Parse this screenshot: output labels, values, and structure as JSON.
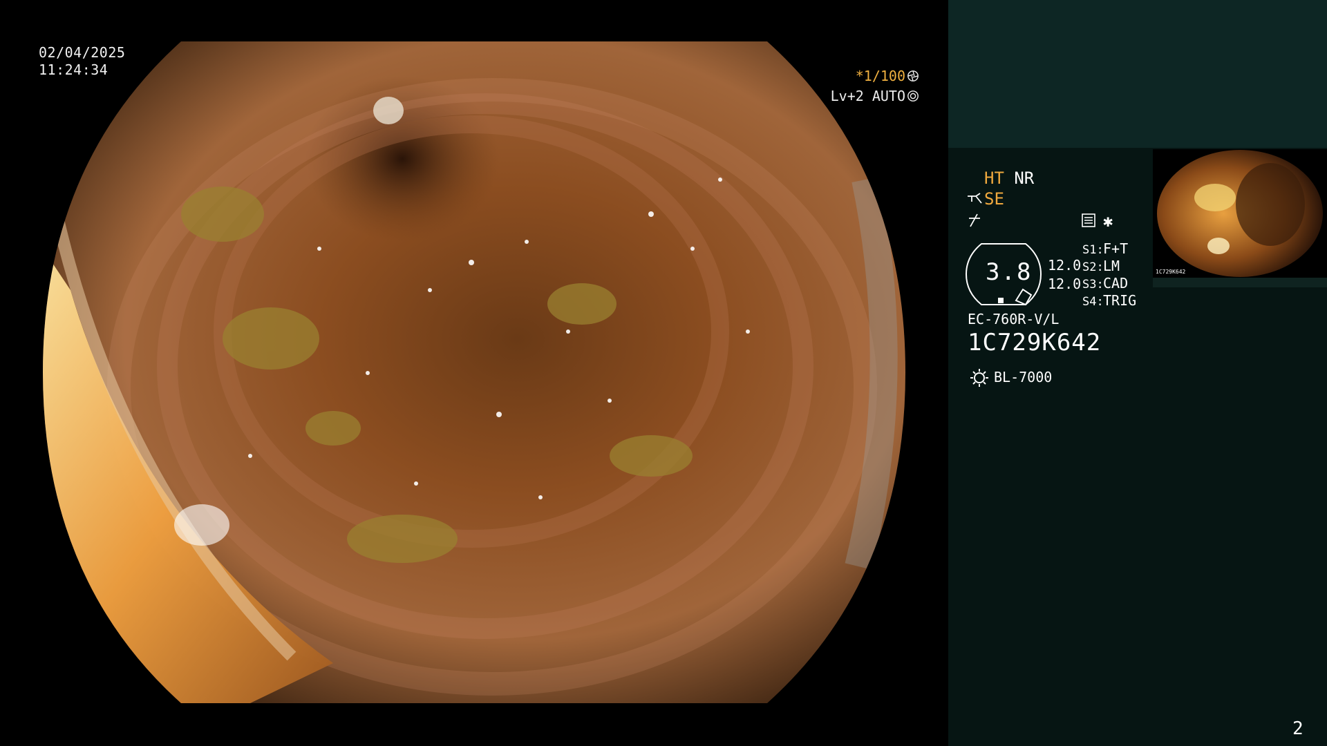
{
  "overlay": {
    "date": "02/04/2025",
    "time": "11:24:34",
    "shutter": "*1/100",
    "iris": "Lv+2 AUTO"
  },
  "panel": {
    "ht": "HT",
    "nr": "NR",
    "se": "SE",
    "zoom_value": "3.8",
    "gauge_value_1": "12.0",
    "gauge_value_2": "12.0",
    "switches": [
      {
        "label": "S1:",
        "value": "F+T"
      },
      {
        "label": "S2:",
        "value": "LM"
      },
      {
        "label": "S3:",
        "value": "CAD"
      },
      {
        "label": "S4:",
        "value": "TRIG"
      }
    ],
    "scope_model": "EC-760R-V/L",
    "serial": "1C729K642",
    "light_source": "BL-7000",
    "thumb_caption": "1C729K642",
    "page_number": "2"
  },
  "colors": {
    "panel_bg": "#061513",
    "panel_top_bg": "#0d2624",
    "amber": "#f0a93e"
  },
  "icons": [
    "aperture-icon",
    "iris-icon",
    "scope-tip-icon",
    "scissors-icon",
    "settings-card-icon",
    "asterisk-icon",
    "light-source-icon"
  ]
}
